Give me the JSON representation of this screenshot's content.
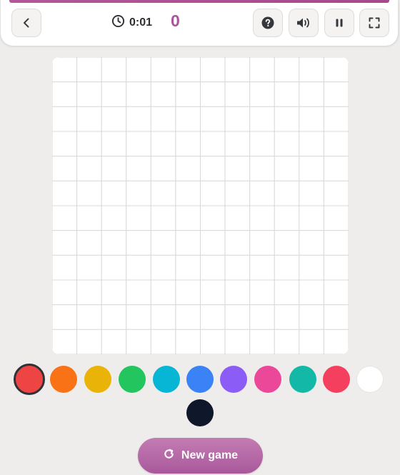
{
  "header": {
    "timer": "0:01",
    "score": "0",
    "back_icon": "chevron-left-icon",
    "timer_icon": "clock-icon",
    "help_icon": "question-icon",
    "sound_icon": "speaker-icon",
    "pause_icon": "pause-icon",
    "fullscreen_icon": "fullscreen-icon",
    "accent_color": "#ad5096"
  },
  "board": {
    "columns": 12,
    "rows": 12,
    "background": "#ffffff",
    "grid_color": "#d9d9d9"
  },
  "palette": {
    "selected_index": 0,
    "colors": [
      "#ef4444",
      "#f97316",
      "#eab308",
      "#22c55e",
      "#06b6d4",
      "#3b82f6",
      "#8b5cf6",
      "#ec4899",
      "#14b8a6",
      "#f43f5e",
      "#ffffff",
      "#0f172a"
    ]
  },
  "actions": {
    "new_game_label": "New game",
    "new_game_icon": "refresh-icon",
    "new_game_color": "#b068a5"
  }
}
